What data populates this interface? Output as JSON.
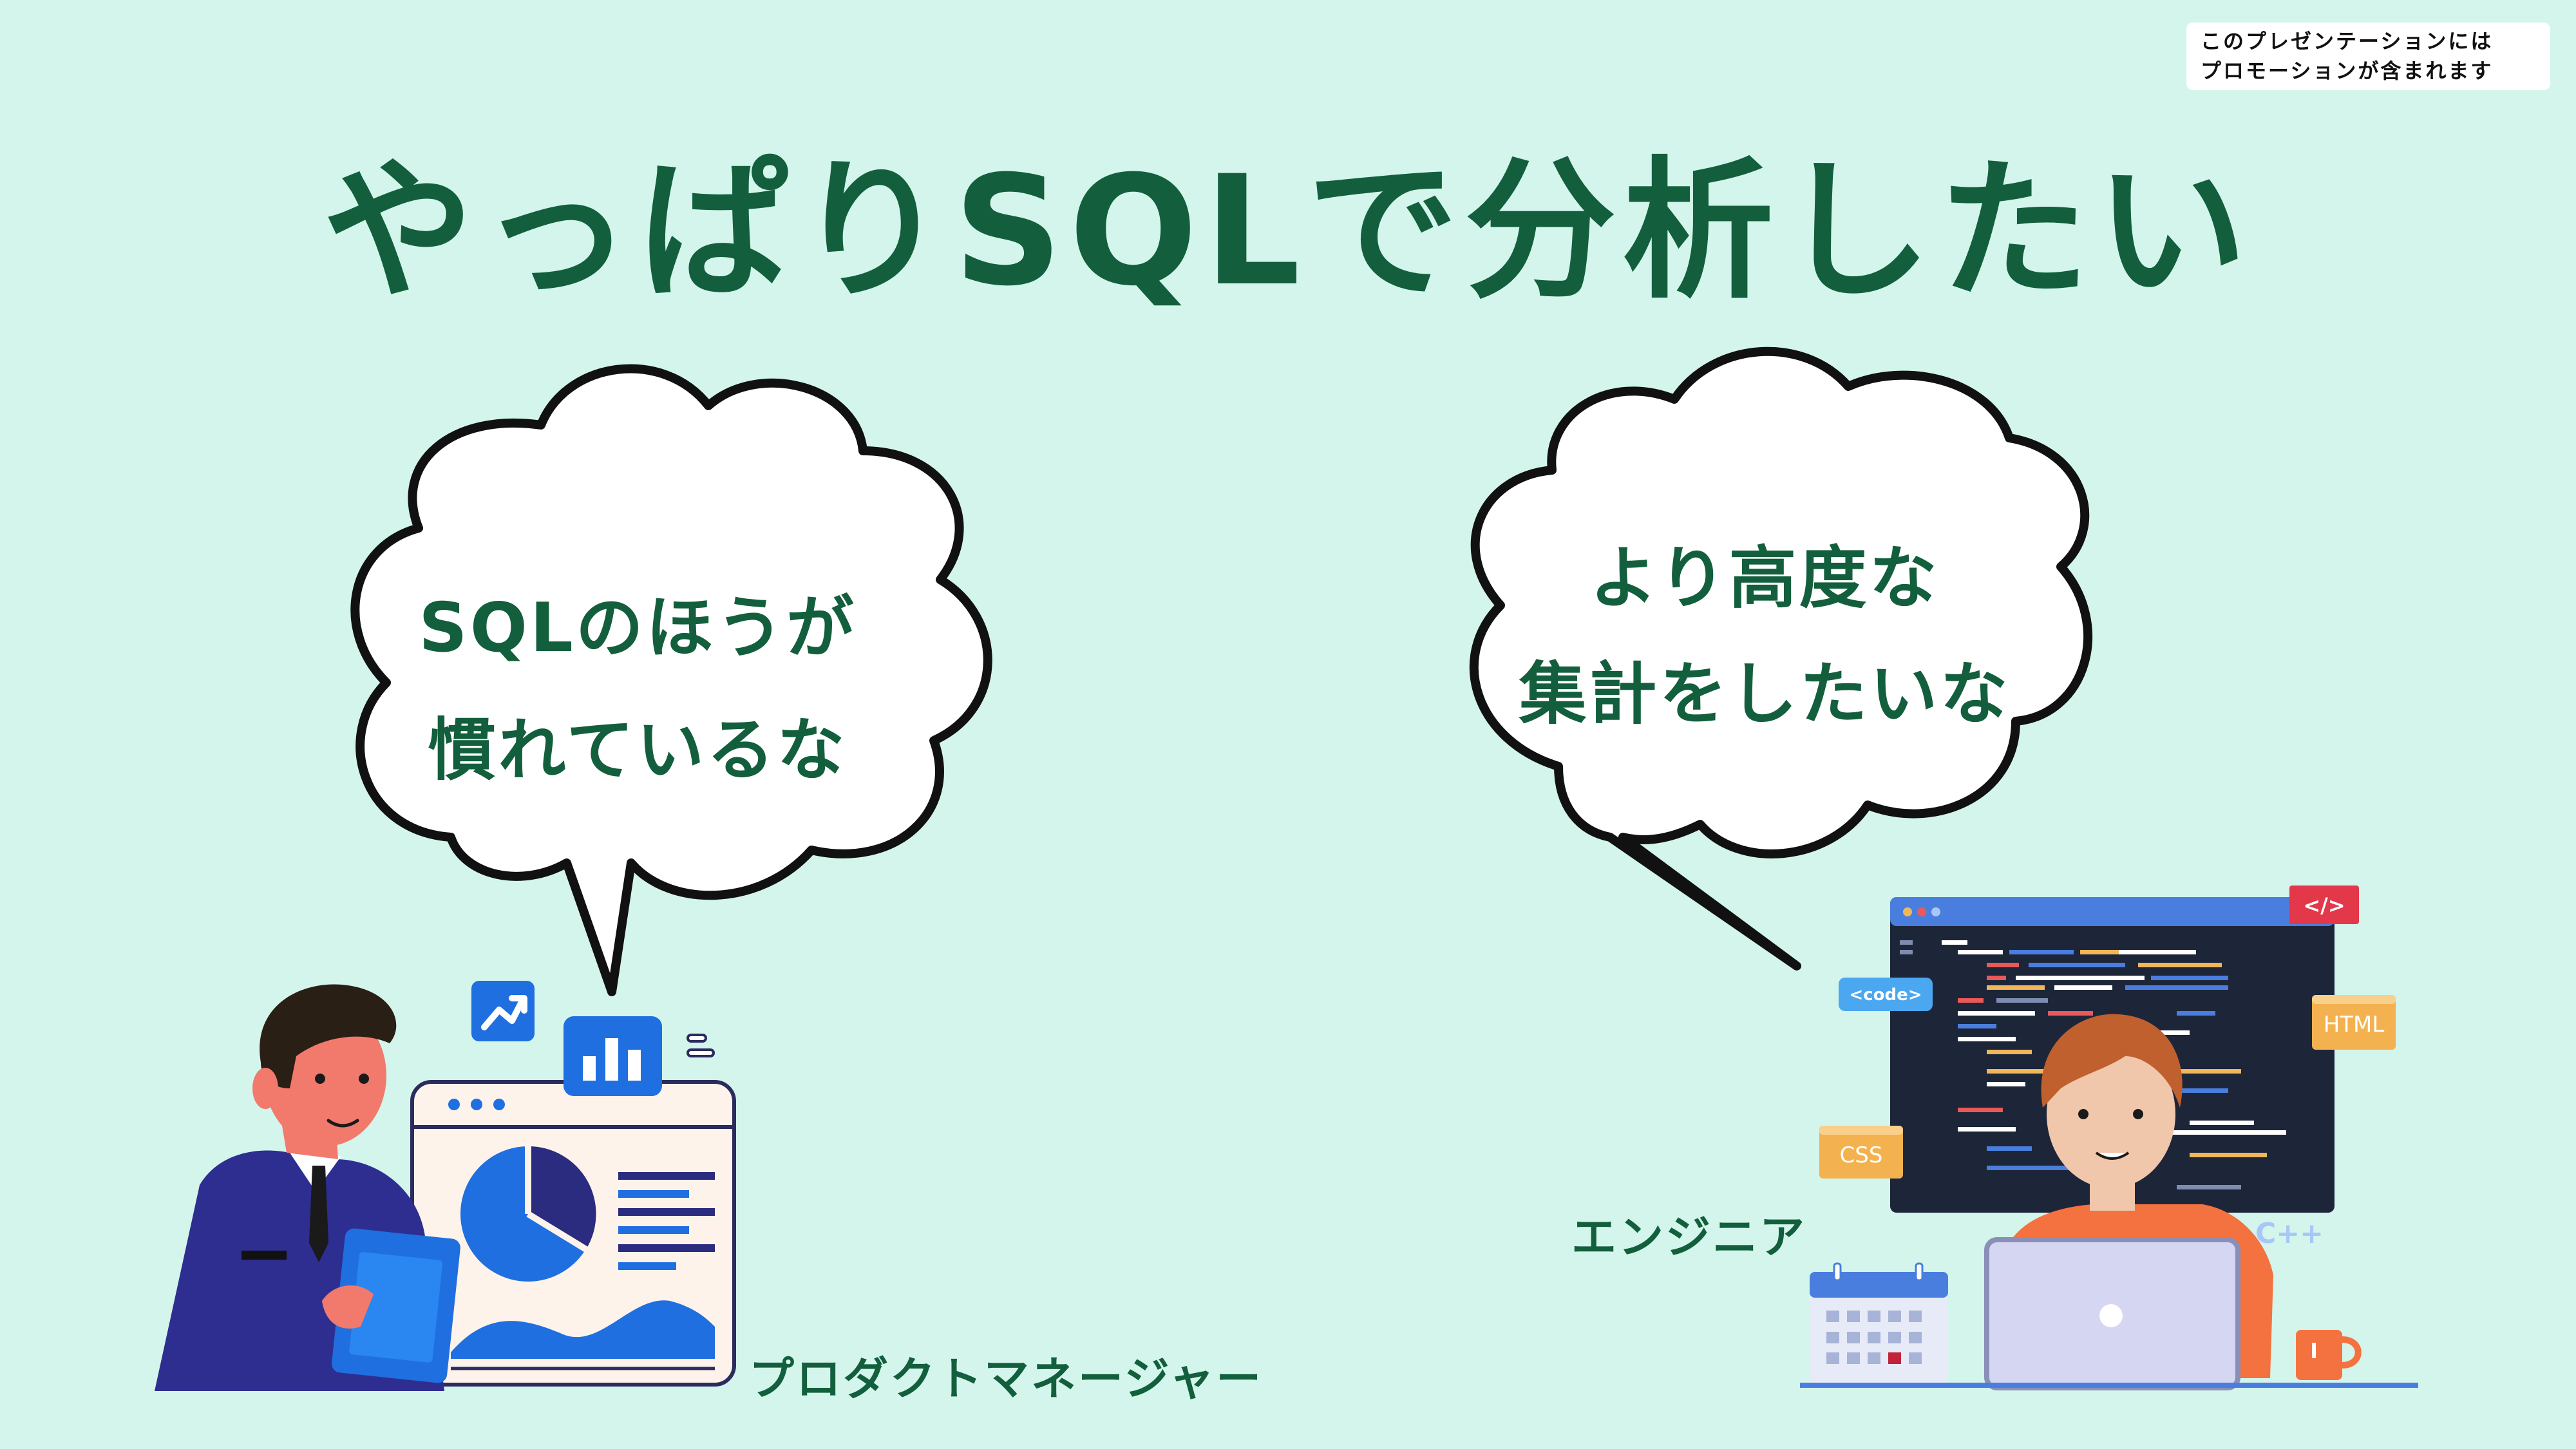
{
  "promo": {
    "line1": "このプレゼンテーションには",
    "line2": "プロモーションが含まれます"
  },
  "title": "やっぱりSQLで分析したい",
  "bubble_left": {
    "line1": "SQLのほうが",
    "line2": "慣れているな"
  },
  "bubble_right": {
    "line1": "より高度な",
    "line2": "集計をしたいな"
  },
  "labels": {
    "product_manager": "プロダクトマネージャー",
    "engineer": "エンジニア"
  },
  "engineer_illustration": {
    "tag_code": "<code>",
    "tag_html": "HTML",
    "tag_css": "CSS",
    "tag_cpp": "C++",
    "tag_close": "</>"
  },
  "colors": {
    "background": "#d3f5ec",
    "title_green": "#135f3d",
    "bubble_fill": "#ffffff",
    "bubble_stroke": "#111111"
  }
}
